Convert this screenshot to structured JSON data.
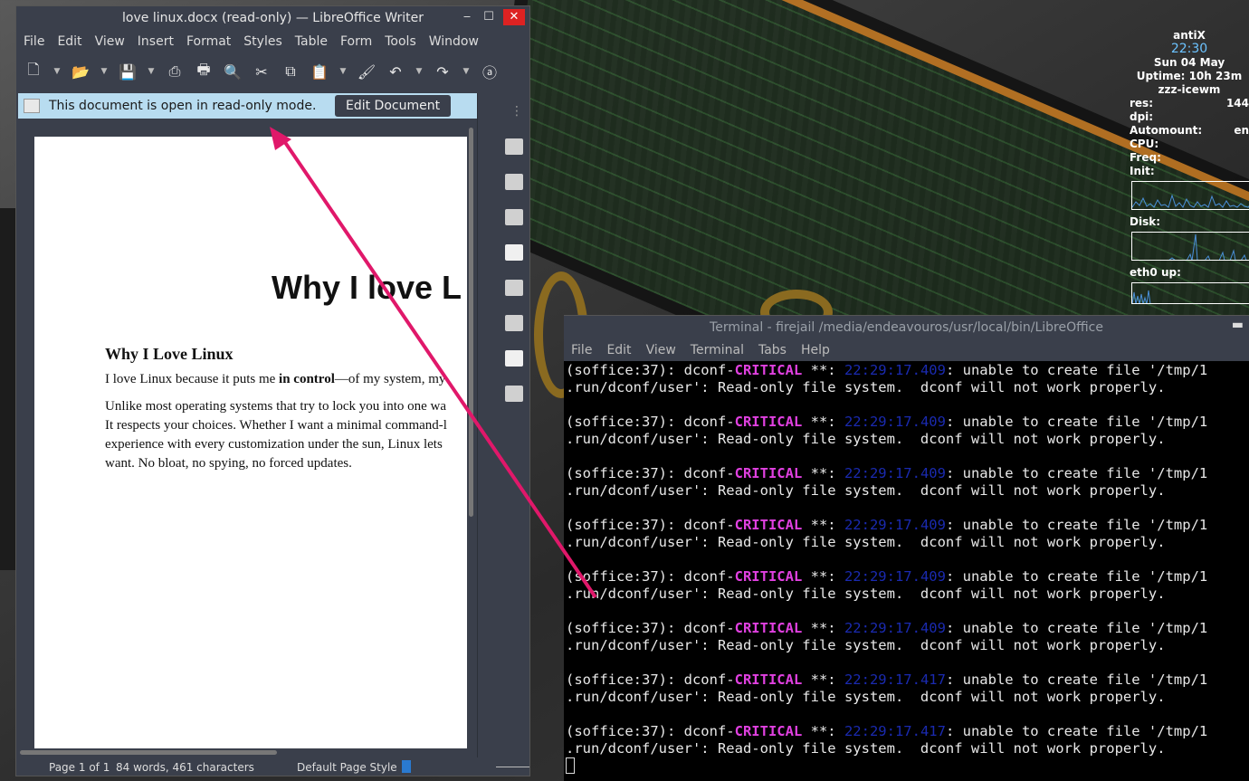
{
  "writer": {
    "title": "love linux.docx (read-only) — LibreOffice Writer",
    "window_buttons": {
      "minimize": "‒",
      "maximize": "☐",
      "close": "✕"
    },
    "menu": [
      "File",
      "Edit",
      "View",
      "Insert",
      "Format",
      "Styles",
      "Table",
      "Form",
      "Tools",
      "Window"
    ],
    "infobar": {
      "message": "This document is open in read-only mode.",
      "edit_button": "Edit Document",
      "close": "✕"
    },
    "document": {
      "heading1": "Why I love L",
      "heading2": "Why I Love Linux",
      "para1_pre": "I love Linux because it puts me ",
      "para1_bold": "in control",
      "para1_post": "—of my system, my",
      "para2": [
        "Unlike most operating systems that try to lock you into one wa",
        "It respects your choices. Whether I want a minimal command-l",
        "experience with every customization under the sun, Linux lets",
        "want. No bloat, no spying, no forced updates."
      ]
    },
    "statusbar": {
      "page": "Page 1 of 1",
      "words": "84 words, 461 characters",
      "page_style": "Default Page Style"
    }
  },
  "terminal": {
    "title": "Terminal - firejail /media/endeavouros/usr/local/bin/LibreOffice",
    "minimize": "▬",
    "menu": [
      "File",
      "Edit",
      "View",
      "Terminal",
      "Tabs",
      "Help"
    ],
    "lines": [
      {
        "pre": "(soffice:37): dconf-",
        "crit": "CRITICAL",
        "mid": " **: ",
        "ts": "22:29:17.409",
        "post": ": unable to create file '/tmp/1",
        "line2": ".run/dconf/user': Read-only file system.  dconf will not work properly."
      },
      {
        "pre": "(soffice:37): dconf-",
        "crit": "CRITICAL",
        "mid": " **: ",
        "ts": "22:29:17.409",
        "post": ": unable to create file '/tmp/1",
        "line2": ".run/dconf/user': Read-only file system.  dconf will not work properly."
      },
      {
        "pre": "(soffice:37): dconf-",
        "crit": "CRITICAL",
        "mid": " **: ",
        "ts": "22:29:17.409",
        "post": ": unable to create file '/tmp/1",
        "line2": ".run/dconf/user': Read-only file system.  dconf will not work properly."
      },
      {
        "pre": "(soffice:37): dconf-",
        "crit": "CRITICAL",
        "mid": " **: ",
        "ts": "22:29:17.409",
        "post": ": unable to create file '/tmp/1",
        "line2": ".run/dconf/user': Read-only file system.  dconf will not work properly."
      },
      {
        "pre": "(soffice:37): dconf-",
        "crit": "CRITICAL",
        "mid": " **: ",
        "ts": "22:29:17.409",
        "post": ": unable to create file '/tmp/1",
        "line2": ".run/dconf/user': Read-only file system.  dconf will not work properly."
      },
      {
        "pre": "(soffice:37): dconf-",
        "crit": "CRITICAL",
        "mid": " **: ",
        "ts": "22:29:17.409",
        "post": ": unable to create file '/tmp/1",
        "line2": ".run/dconf/user': Read-only file system.  dconf will not work properly."
      },
      {
        "pre": "(soffice:37): dconf-",
        "crit": "CRITICAL",
        "mid": " **: ",
        "ts": "22:29:17.417",
        "post": ": unable to create file '/tmp/1",
        "line2": ".run/dconf/user': Read-only file system.  dconf will not work properly."
      },
      {
        "pre": "(soffice:37): dconf-",
        "crit": "CRITICAL",
        "mid": " **: ",
        "ts": "22:29:17.417",
        "post": ": unable to create file '/tmp/1",
        "line2": ".run/dconf/user': Read-only file system.  dconf will not work properly."
      }
    ]
  },
  "conky": {
    "host": "antiX",
    "time": "22:30",
    "date": "Sun 04 May",
    "uptime": "Uptime: 10h 23m",
    "wm": "zzz-icewm",
    "res_label": "res:",
    "res_value": "144",
    "dpi_label": "dpi:",
    "automount_label": "Automount:",
    "automount_value": "en",
    "cpu_label": "CPU:",
    "freq_label": "Freq:",
    "init_label": "Init:",
    "disk_label": "Disk:",
    "eth_label": "eth0 up:",
    "graph_color": "#4a90d9"
  },
  "colors": {
    "annotation_arrow": "#e0186a",
    "critical": "#e040e0",
    "timestamp": "#1a2ab0"
  }
}
